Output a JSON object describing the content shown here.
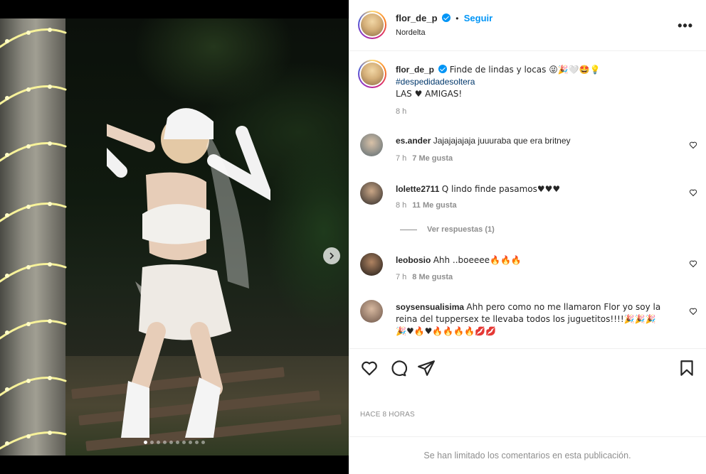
{
  "post": {
    "author": "flor_de_p",
    "follow_label": "Seguir",
    "location": "Nordelta",
    "caption": {
      "text": "Finde de lindas y locas 😜🎉🤍🤩💡",
      "hashtag": "#despedidadesoltera",
      "line3": "LAS ♥ AMIGAS!",
      "time": "8 h"
    },
    "media": {
      "active_dot": 0,
      "dot_count": 10
    }
  },
  "comments": [
    {
      "user": "es.ander",
      "text": "Jajajajajaja juuuraba que era britney",
      "time": "7 h",
      "likes": "7 Me gusta"
    },
    {
      "user": "lolette2711",
      "text": "Q lindo finde pasamos♥♥♥",
      "time": "8 h",
      "likes": "11 Me gusta"
    },
    {
      "user": "leobosio",
      "text": "Ahh ..boeeee🔥🔥🔥",
      "time": "7 h",
      "likes": "8 Me gusta"
    },
    {
      "user": "soysensualisima",
      "text": "Ahh pero como no me llamaron Flor yo soy la reina del tuppersex te llevaba todos los juguetitos!!!!🎉🎉🎉",
      "line2": "🎉♥🔥♥🔥🔥🔥🔥💋💋"
    }
  ],
  "replies_label": "Ver respuestas (1)",
  "timestamp": "HACE 8 HORAS",
  "limited_notice": "Se han limitado los comentarios en esta publicación.",
  "colors": {
    "link": "#0095f6",
    "hashtag": "#00376b",
    "meta": "#8e8e8e"
  },
  "icons": [
    "heart-icon",
    "comment-icon",
    "share-icon",
    "bookmark-icon",
    "more-icon",
    "verified-icon",
    "chevron-right-icon"
  ]
}
